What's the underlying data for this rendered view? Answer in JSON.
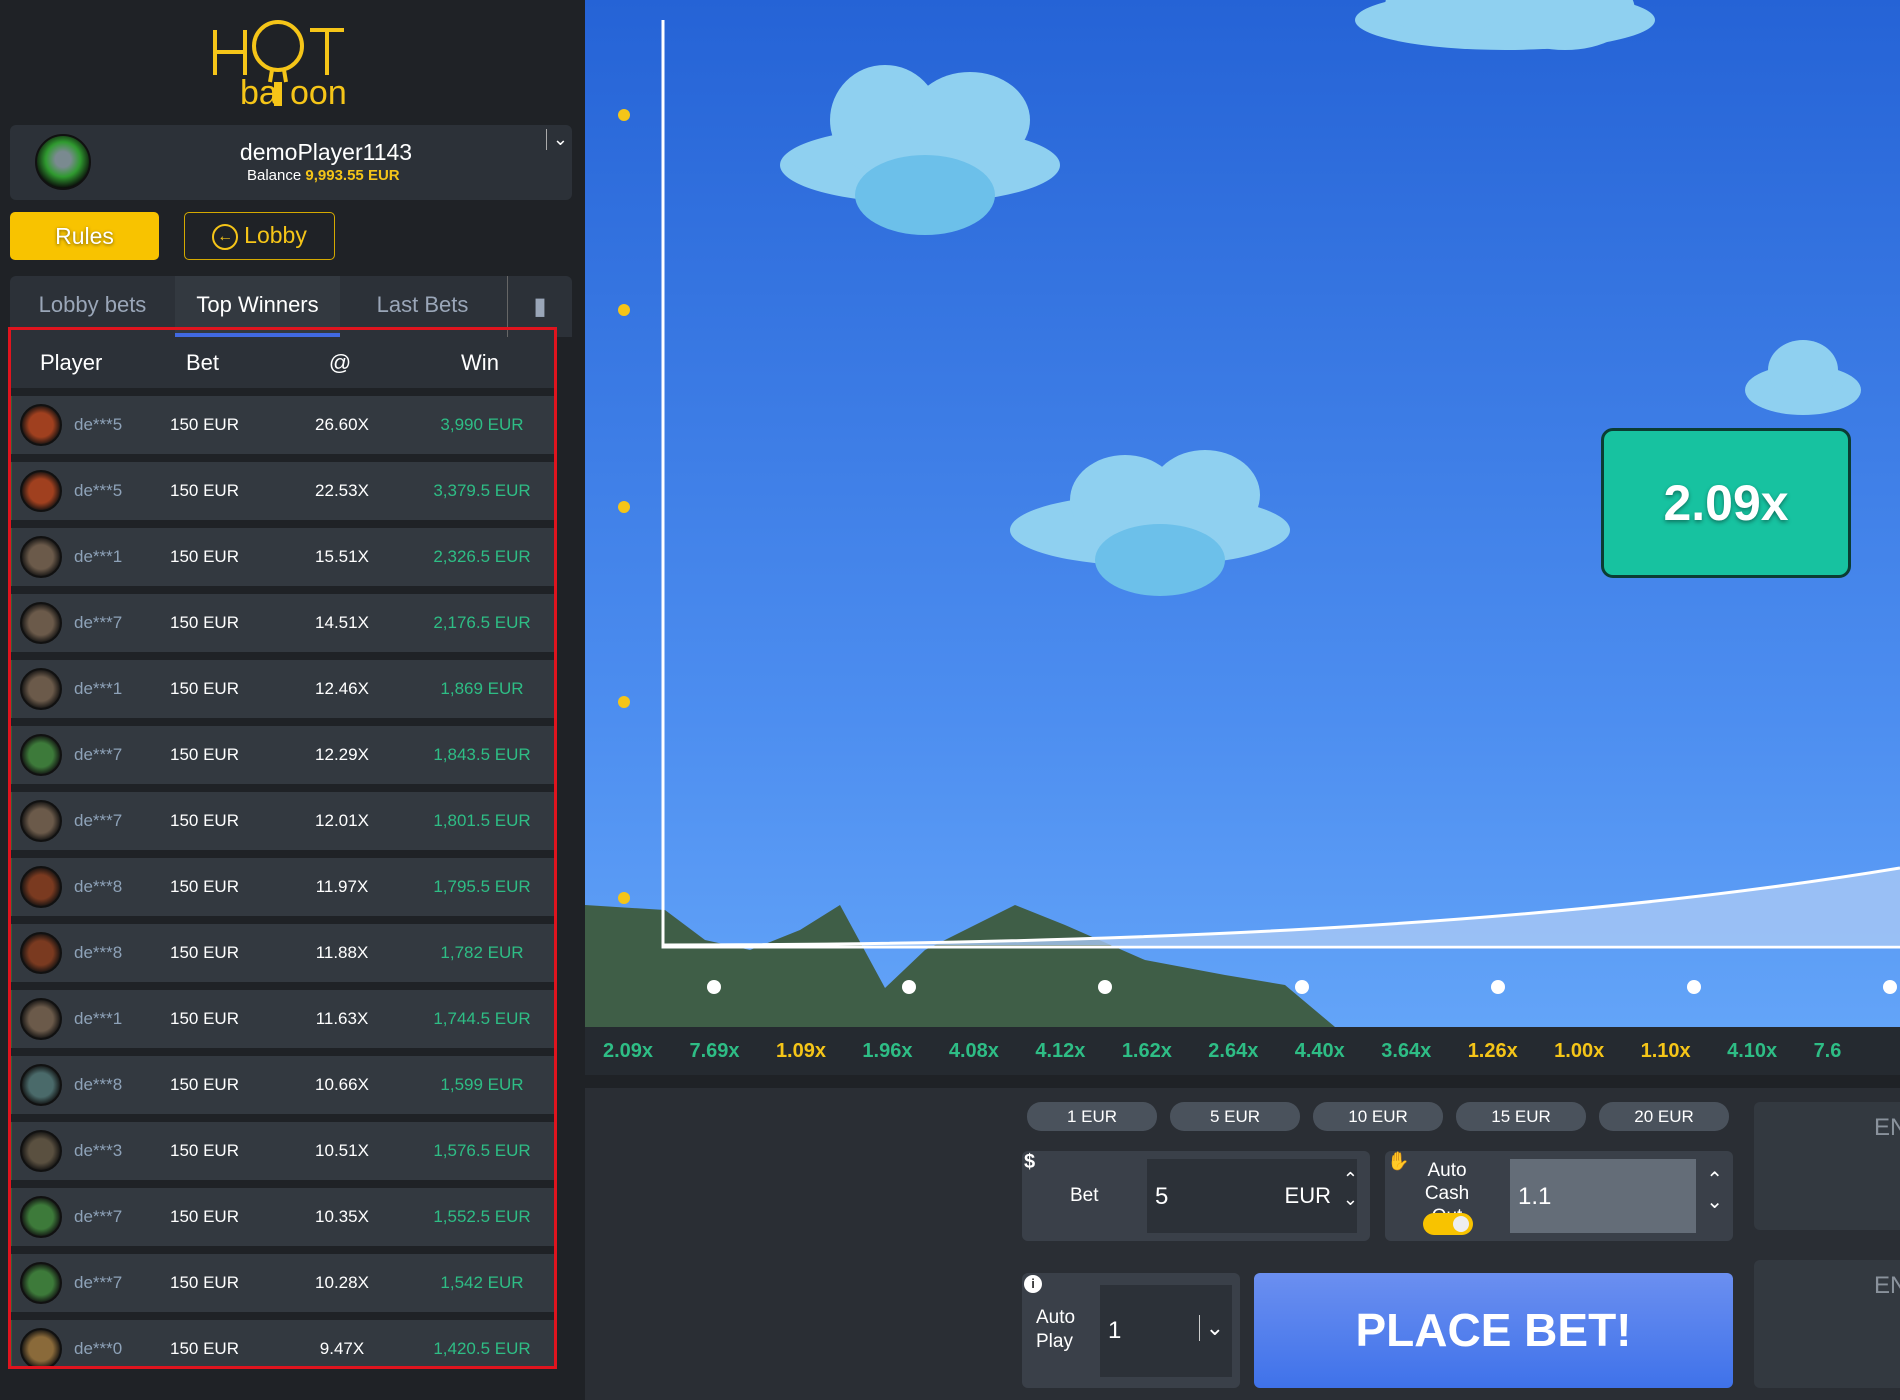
{
  "logo": {
    "text": "HOT balloon"
  },
  "profile": {
    "username": "demoPlayer1143",
    "balance_label": "Balance",
    "balance": "9,993.55 EUR"
  },
  "buttons": {
    "rules": "Rules",
    "lobby": "Lobby"
  },
  "tabs": [
    {
      "label": "Lobby bets"
    },
    {
      "label": "Top Winners",
      "active": true
    },
    {
      "label": "Last Bets"
    }
  ],
  "table": {
    "headers": [
      "Player",
      "Bet",
      "@",
      "Win"
    ],
    "rows": [
      {
        "player": "de***5",
        "bet": "150 EUR",
        "mult": "26.60X",
        "win": "3,990 EUR",
        "avatar": "#a0401f"
      },
      {
        "player": "de***5",
        "bet": "150 EUR",
        "mult": "22.53X",
        "win": "3,379.5 EUR",
        "avatar": "#a0401f"
      },
      {
        "player": "de***1",
        "bet": "150 EUR",
        "mult": "15.51X",
        "win": "2,326.5 EUR",
        "avatar": "#6b5a4a"
      },
      {
        "player": "de***7",
        "bet": "150 EUR",
        "mult": "14.51X",
        "win": "2,176.5 EUR",
        "avatar": "#6b5a4a"
      },
      {
        "player": "de***1",
        "bet": "150 EUR",
        "mult": "12.46X",
        "win": "1,869 EUR",
        "avatar": "#6b5a4a"
      },
      {
        "player": "de***7",
        "bet": "150 EUR",
        "mult": "12.29X",
        "win": "1,843.5 EUR",
        "avatar": "#3d7a3a"
      },
      {
        "player": "de***7",
        "bet": "150 EUR",
        "mult": "12.01X",
        "win": "1,801.5 EUR",
        "avatar": "#6b5a4a"
      },
      {
        "player": "de***8",
        "bet": "150 EUR",
        "mult": "11.97X",
        "win": "1,795.5 EUR",
        "avatar": "#7a3a20"
      },
      {
        "player": "de***8",
        "bet": "150 EUR",
        "mult": "11.88X",
        "win": "1,782 EUR",
        "avatar": "#7a3a20"
      },
      {
        "player": "de***1",
        "bet": "150 EUR",
        "mult": "11.63X",
        "win": "1,744.5 EUR",
        "avatar": "#6b5a4a"
      },
      {
        "player": "de***8",
        "bet": "150 EUR",
        "mult": "10.66X",
        "win": "1,599 EUR",
        "avatar": "#4a6a6a"
      },
      {
        "player": "de***3",
        "bet": "150 EUR",
        "mult": "10.51X",
        "win": "1,576.5 EUR",
        "avatar": "#5a5040"
      },
      {
        "player": "de***7",
        "bet": "150 EUR",
        "mult": "10.35X",
        "win": "1,552.5 EUR",
        "avatar": "#3d7a3a"
      },
      {
        "player": "de***7",
        "bet": "150 EUR",
        "mult": "10.28X",
        "win": "1,542 EUR",
        "avatar": "#3d7a3a"
      },
      {
        "player": "de***0",
        "bet": "150 EUR",
        "mult": "9.47X",
        "win": "1,420.5 EUR",
        "avatar": "#8a6a3a"
      }
    ]
  },
  "game": {
    "multiplier": "2.09x"
  },
  "history": [
    {
      "v": "2.09x",
      "c": "#2ebd85"
    },
    {
      "v": "7.69x",
      "c": "#2ebd85"
    },
    {
      "v": "1.09x",
      "c": "#f5c518"
    },
    {
      "v": "1.96x",
      "c": "#2ebd85"
    },
    {
      "v": "4.08x",
      "c": "#2ebd85"
    },
    {
      "v": "4.12x",
      "c": "#2ebd85"
    },
    {
      "v": "1.62x",
      "c": "#2ebd85"
    },
    {
      "v": "2.64x",
      "c": "#2ebd85"
    },
    {
      "v": "4.40x",
      "c": "#2ebd85"
    },
    {
      "v": "3.64x",
      "c": "#2ebd85"
    },
    {
      "v": "1.26x",
      "c": "#f5c518"
    },
    {
      "v": "1.00x",
      "c": "#f5c518"
    },
    {
      "v": "1.10x",
      "c": "#f5c518"
    },
    {
      "v": "4.10x",
      "c": "#2ebd85"
    },
    {
      "v": "7.6",
      "c": "#2ebd85"
    }
  ],
  "controls": {
    "chips": [
      "1 EUR",
      "5 EUR",
      "10 EUR",
      "15 EUR",
      "20 EUR"
    ],
    "bet_label": "Bet",
    "bet_value": "5",
    "currency": "EUR",
    "cashout_label": "Auto Cash Out",
    "cashout_value": "1.1",
    "cashout_enabled": true,
    "autoplay_label": "Auto Play",
    "autoplay_value": "1",
    "place_bet": "PLACE BET!",
    "right_panel_1": "EN",
    "right_panel_2": "EN"
  },
  "colors": {
    "accent": "#f8c300",
    "win": "#2ebd85",
    "place_bet": "#4a7df0",
    "multiplier_box": "#17c2a0"
  }
}
